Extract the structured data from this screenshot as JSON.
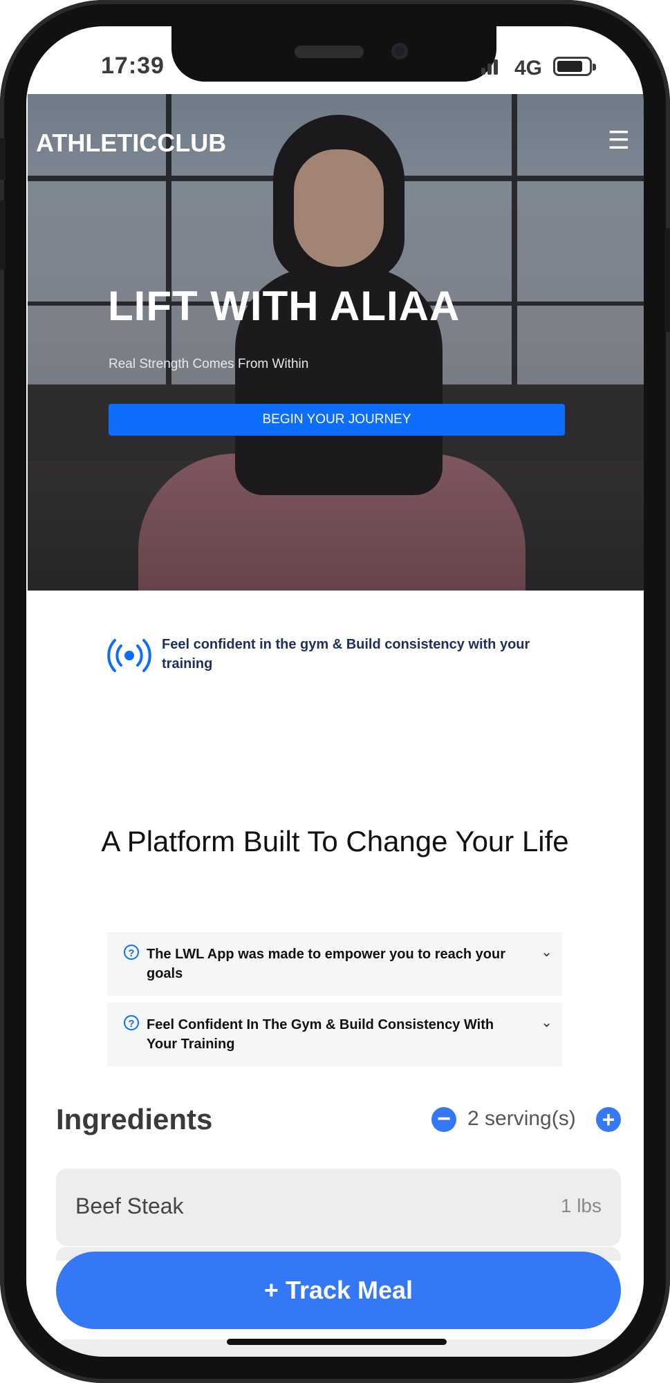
{
  "status_bar": {
    "time": "17:39",
    "network": "4G"
  },
  "header": {
    "brand": "ATHLETICCLUB",
    "menu_icon": "hamburger-menu-icon"
  },
  "hero": {
    "title": "LIFT WITH ALIAA",
    "subtitle": "Real Strength Comes From Within",
    "cta_label": "BEGIN YOUR JOURNEY"
  },
  "feature": {
    "icon": "broadcast-icon",
    "text": "Feel confident in the gym & Build consistency with your training"
  },
  "platform": {
    "title": "A Platform Built To Change Your Life",
    "faq": [
      {
        "question": "The LWL App was made to empower you to reach your goals"
      },
      {
        "question": "Feel Confident In The Gym & Build Consistency With Your Training"
      }
    ]
  },
  "ingredients": {
    "title": "Ingredients",
    "servings_label": "2 serving(s)",
    "items": [
      {
        "name": "Beef Steak",
        "quantity": "1 lbs"
      }
    ],
    "track_button": "+ Track Meal"
  },
  "colors": {
    "accent": "#0d6efd",
    "app_blue": "#3478f6",
    "feature_text": "#1e2f5f"
  }
}
